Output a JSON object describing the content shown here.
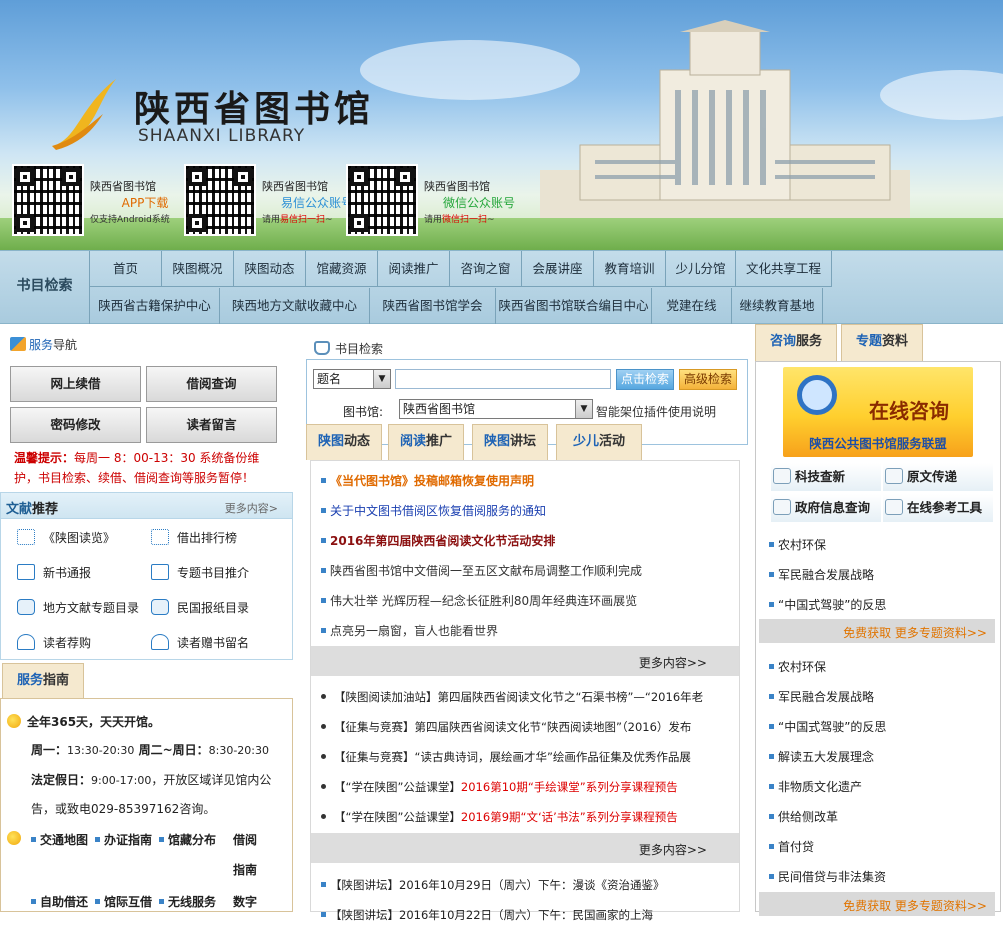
{
  "banner": {
    "logo_cn": "陕西省图书馆",
    "logo_en": "SHAANXI LIBRARY",
    "qr_codes": [
      {
        "line1": "陕西省图书馆",
        "line2": "APP下载",
        "line3": "仅支持Android系统"
      },
      {
        "line1": "陕西省图书馆",
        "line2": "易信公众账号",
        "line3_pre": "请用",
        "line3_hl": "易信扫一扫",
        "line3_post": "~"
      },
      {
        "line1": "陕西省图书馆",
        "line2": "微信公众账号",
        "line3_pre": "请用",
        "line3_hl": "微信扫一扫",
        "line3_post": "~"
      }
    ]
  },
  "nav": {
    "search_label": "书目检索",
    "row1": [
      "首页",
      "陕图概况",
      "陕图动态",
      "馆藏资源",
      "阅读推广",
      "咨询之窗",
      "会展讲座",
      "教育培训",
      "少儿分馆",
      "文化共享工程"
    ],
    "row2": [
      "陕西省古籍保护中心",
      "陕西地方文献收藏中心",
      "陕西省图书馆学会",
      "陕西省图书馆联合编目中心",
      "党建在线",
      "继续教育基地"
    ]
  },
  "left": {
    "service_nav": {
      "pre": "服务",
      "post": "导航"
    },
    "service_buttons": [
      "网上续借",
      "借阅查询",
      "密码修改",
      "读者留言"
    ],
    "warning": {
      "prefix": "温馨提示：",
      "text": "每周一 8：00-13：30 系统备份维护，书目检索、续借、借阅查询等服务暂停！"
    },
    "recommend": {
      "title_hl": "文献",
      "title_rest": "推荐",
      "more": "更多内容>",
      "items": [
        "《陕图读览》",
        "借出排行榜",
        "新书通报",
        "专题书目推介",
        "地方文献专题目录",
        "民国报纸目录",
        "读者荐购",
        "读者赠书留名"
      ]
    },
    "guide": {
      "tab_hl": "服务",
      "tab_rest": "指南",
      "line1": "全年365天，天天开馆。",
      "line2a": "周一：",
      "line2b": "13:30-20:30",
      "line2c": " 周二~周日：",
      "line2d": "8:30-20:30",
      "line3a": "法定假日：",
      "line3b": "9:00-17:00",
      "line3c": "，开放区域详见馆内公",
      "line4": "告，或致电029-85397162咨询。",
      "links1": [
        "交通地图",
        "办证指南",
        "馆藏分布"
      ],
      "links1_extra_top": "借阅",
      "links1_extra_bottom": "指南",
      "links2": [
        "自助借还",
        "馆际互借",
        "无线服务",
        "数字"
      ]
    }
  },
  "mid": {
    "search": {
      "title": "书目检索",
      "field_select": "题名",
      "query_value": "",
      "search_button": "点击检索",
      "advanced_button": "高级检索",
      "library_label": "图书馆:",
      "library_select": "陕西省图书馆",
      "plugin_text": "智能架位插件使用说明"
    },
    "tabs": [
      {
        "hl": "陕图",
        "rest": "动态"
      },
      {
        "hl": "阅读",
        "rest": "推广"
      },
      {
        "hl": "陕图",
        "rest": "讲坛"
      },
      {
        "hl": "少儿",
        "rest": "活动"
      }
    ],
    "news1": [
      {
        "text": "《当代图书馆》投稿邮箱恢复使用声明",
        "color": "#e06a00",
        "bold": true
      },
      {
        "text": "关于中文图书借阅区恢复借阅服务的通知",
        "color": "#1a3fb0",
        "bold": false
      },
      {
        "text": "2016年第四届陕西省阅读文化节活动安排",
        "color": "#8b1010",
        "bold": true
      },
      {
        "text": "陕西省图书馆中文借阅一至五区文献布局调整工作顺利完成",
        "color": "#333333",
        "bold": false
      },
      {
        "text": "伟大壮举 光辉历程—纪念长征胜利80周年经典连环画展览",
        "color": "#333333",
        "bold": false
      },
      {
        "text": "点亮另一扇窗，盲人也能看世界",
        "color": "#333333",
        "bold": false
      }
    ],
    "more_label": "更多内容>>",
    "news2": [
      {
        "pre": "【陕图阅读加油站】第四届陕西省阅读文化节之“石渠书榜”—“2016年老",
        "hl": ""
      },
      {
        "pre": "【征集与竞赛】第四届陕西省阅读文化节“陕西阅读地图”（2016）发布",
        "hl": ""
      },
      {
        "pre": "【征集与竞赛】“读古典诗词，展绘画才华”绘画作品征集及优秀作品展",
        "hl": ""
      },
      {
        "pre": "【“学在陕图”公益课堂】",
        "hl": "2016第10期“手绘课堂”系列分享课程预告"
      },
      {
        "pre": "【“学在陕图”公益课堂】",
        "hl": "2016第9期“文‘话’书法”系列分享课程预告"
      }
    ],
    "news3": [
      "【陕图讲坛】2016年10月29日（周六）下午：漫谈《资治通鉴》",
      "【陕图讲坛】2016年10月22日（周六）下午：民国画家的上海"
    ]
  },
  "right": {
    "tabs": [
      {
        "hl": "咨询",
        "rest": "服务"
      },
      {
        "hl": "专题",
        "rest": "资料"
      }
    ],
    "consult_title": "在线咨询",
    "consult_sub": "陕西公共图书馆服务联盟",
    "buttons": [
      "科技查新",
      "原文传递",
      "政府信息查询",
      "在线参考工具"
    ],
    "topics1": [
      "农村环保",
      "军民融合发展战略",
      "“中国式驾驶”的反思"
    ],
    "freebar": "免费获取  更多专题资料>>",
    "topics2": [
      "农村环保",
      "军民融合发展战略",
      "“中国式驾驶”的反思",
      "解读五大发展理念",
      "非物质文化遗产",
      "供给侧改革",
      "首付贷",
      "民间借贷与非法集资"
    ],
    "freebar2": "免费获取  更多专题资料>>"
  },
  "colors": {
    "accent_blue": "#1e63b5",
    "orange": "#e06a00",
    "nav_bg": "#b6d4e4",
    "tab_bg": "#f5e9cf"
  }
}
